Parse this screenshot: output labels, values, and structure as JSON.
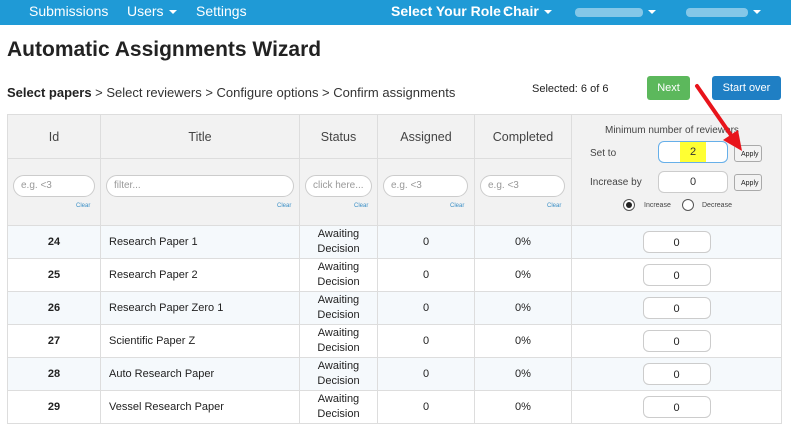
{
  "nav": {
    "submissions": "Submissions",
    "users": "Users",
    "settings": "Settings",
    "role_label": "Select Your Role :",
    "role_value": "Chair"
  },
  "page": {
    "title": "Automatic Assignments Wizard",
    "steps": {
      "current": "Select papers",
      "rest": " > Select reviewers > Configure options > Confirm assignments"
    },
    "selected": "Selected: 6 of 6",
    "next_label": "Next",
    "start_over_label": "Start over"
  },
  "table": {
    "headers": [
      "Id",
      "Title",
      "Status",
      "Assigned",
      "Completed"
    ],
    "filters": {
      "id_placeholder": "e.g. <3",
      "title_placeholder": "filter...",
      "status_placeholder": "click here...",
      "assigned_placeholder": "e.g. <3",
      "completed_placeholder": "e.g. <3",
      "clear_label": "Clear"
    },
    "rows": [
      {
        "id": "24",
        "title": "Research Paper 1",
        "status": "Awaiting Decision",
        "assigned": "0",
        "completed": "0%",
        "min": "0"
      },
      {
        "id": "25",
        "title": "Research Paper 2",
        "status": "Awaiting Decision",
        "assigned": "0",
        "completed": "0%",
        "min": "0"
      },
      {
        "id": "26",
        "title": "Research Paper Zero 1",
        "status": "Awaiting Decision",
        "assigned": "0",
        "completed": "0%",
        "min": "0"
      },
      {
        "id": "27",
        "title": "Scientific Paper Z",
        "status": "Awaiting Decision",
        "assigned": "0",
        "completed": "0%",
        "min": "0"
      },
      {
        "id": "28",
        "title": "Auto Research Paper",
        "status": "Awaiting Decision",
        "assigned": "0",
        "completed": "0%",
        "min": "0"
      },
      {
        "id": "29",
        "title": "Vessel Research Paper",
        "status": "Awaiting Decision",
        "assigned": "0",
        "completed": "0%",
        "min": "0"
      }
    ]
  },
  "min_panel": {
    "heading": "Minimum number of reviewers",
    "set_to_label": "Set to",
    "set_to_value": "2",
    "increase_by_label": "Increase by",
    "increase_by_value": "0",
    "apply_label": "Apply",
    "increase_label": "Increase",
    "decrease_label": "Decrease"
  },
  "colors": {
    "navbar": "#1f9ad6",
    "next": "#5cb85c",
    "start_over": "#1f7fc4",
    "highlight": "#ffff33",
    "arrow": "#e8141b"
  }
}
